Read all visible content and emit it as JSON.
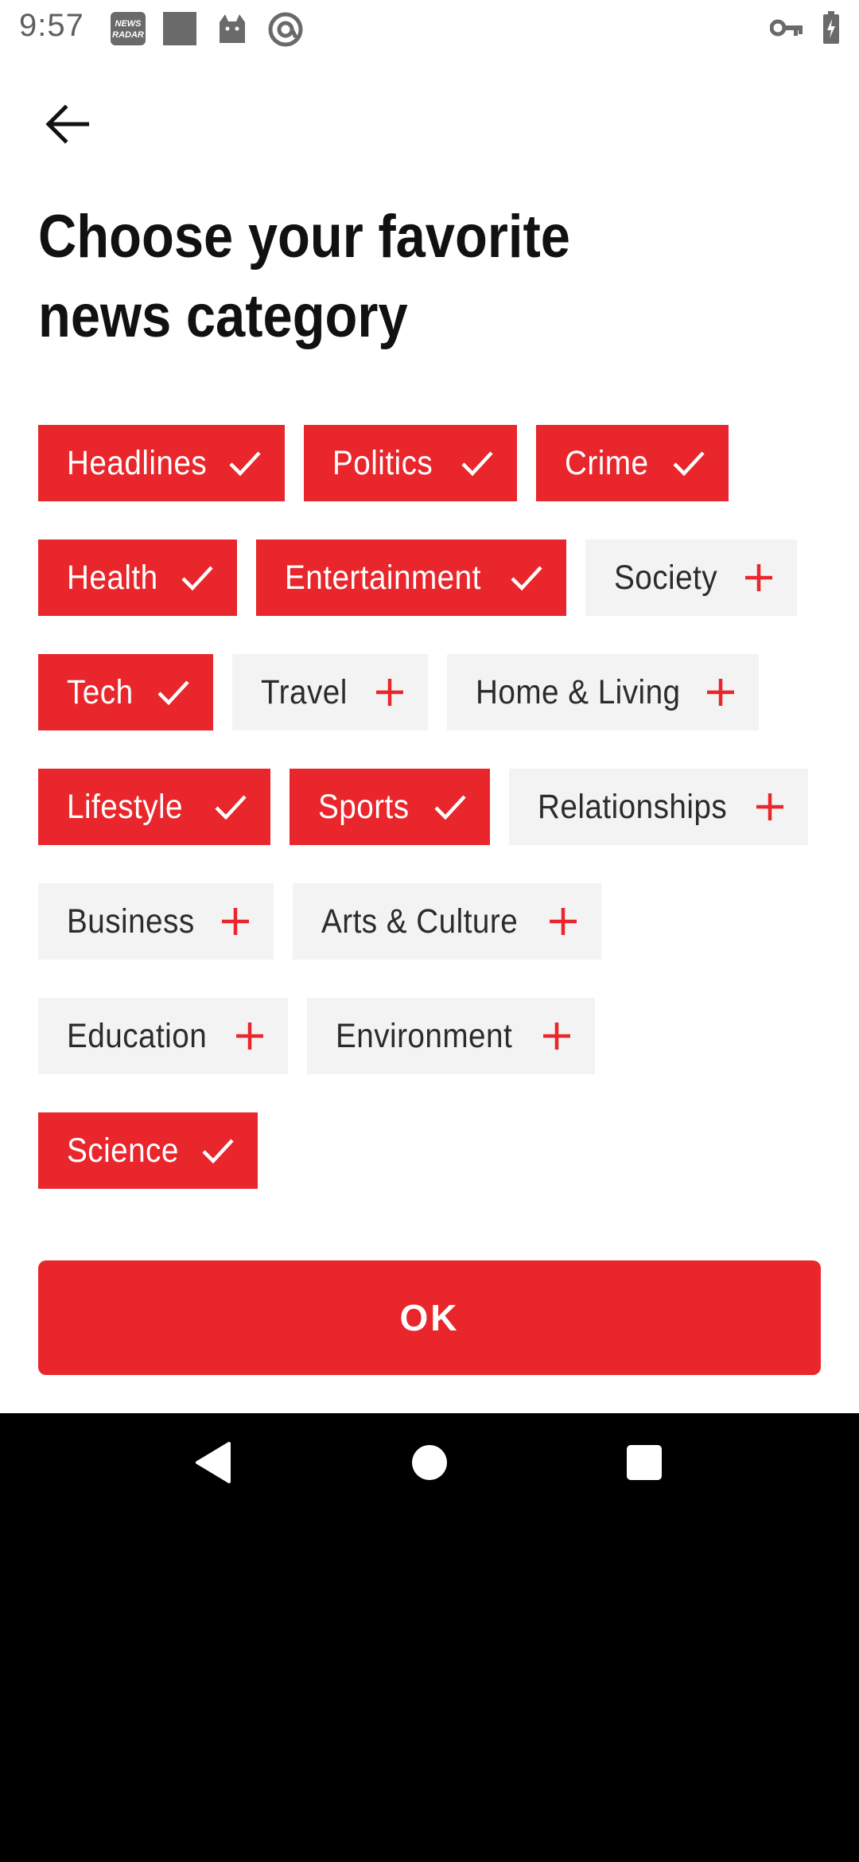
{
  "status_bar": {
    "time": "9:57",
    "left_icons": [
      "news-radar-app-icon",
      "square-app-icon",
      "cat-app-icon",
      "at-sign-icon"
    ],
    "right_icons": [
      "vpn-key-icon",
      "battery-charging-icon"
    ]
  },
  "header": {
    "back_icon": "arrow-left-icon",
    "title": "Choose your favorite news category"
  },
  "categories": [
    {
      "label": "Headlines",
      "selected": true
    },
    {
      "label": "Politics",
      "selected": true
    },
    {
      "label": "Crime",
      "selected": true
    },
    {
      "label": "Health",
      "selected": true
    },
    {
      "label": "Entertainment",
      "selected": true
    },
    {
      "label": "Society",
      "selected": false
    },
    {
      "label": "Tech",
      "selected": true
    },
    {
      "label": "Travel",
      "selected": false
    },
    {
      "label": "Home & Living",
      "selected": false
    },
    {
      "label": "Lifestyle",
      "selected": true
    },
    {
      "label": "Sports",
      "selected": true
    },
    {
      "label": "Relationships",
      "selected": false
    },
    {
      "label": "Business",
      "selected": false
    },
    {
      "label": "Arts & Culture",
      "selected": false
    },
    {
      "label": "Education",
      "selected": false
    },
    {
      "label": "Environment",
      "selected": false
    },
    {
      "label": "Science",
      "selected": true
    }
  ],
  "ok_button": {
    "label": "OK"
  },
  "colors": {
    "accent": "#e8262b",
    "chip_unselected_bg": "#f3f3f3",
    "text_dark": "#111111"
  },
  "nav_bar": {
    "icons": [
      "back-triangle-icon",
      "home-circle-icon",
      "recents-square-icon"
    ]
  }
}
